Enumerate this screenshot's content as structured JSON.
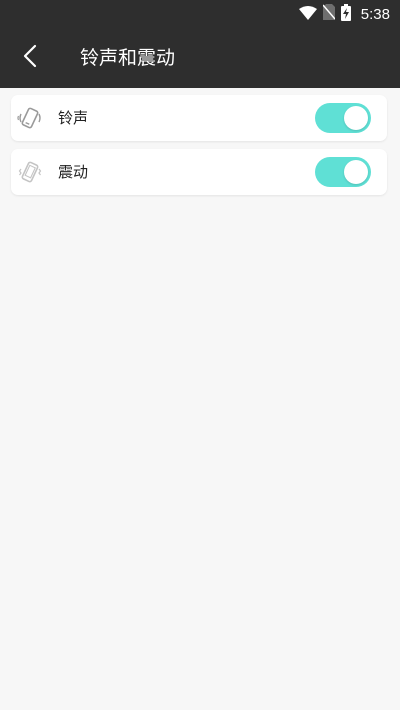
{
  "status_bar": {
    "time": "5:38",
    "icons": [
      "wifi-icon",
      "no-sim-icon",
      "battery-charging-icon"
    ]
  },
  "header": {
    "back_icon": "chevron-left-icon",
    "title": "铃声和震动"
  },
  "settings": [
    {
      "label": "铃声",
      "icon": "ringtone-icon",
      "enabled": true
    },
    {
      "label": "震动",
      "icon": "vibrate-icon",
      "enabled": true
    }
  ],
  "colors": {
    "app_bar": "#2e2e2e",
    "toggle_on": "#5fe0d5",
    "background": "#f7f7f7"
  }
}
